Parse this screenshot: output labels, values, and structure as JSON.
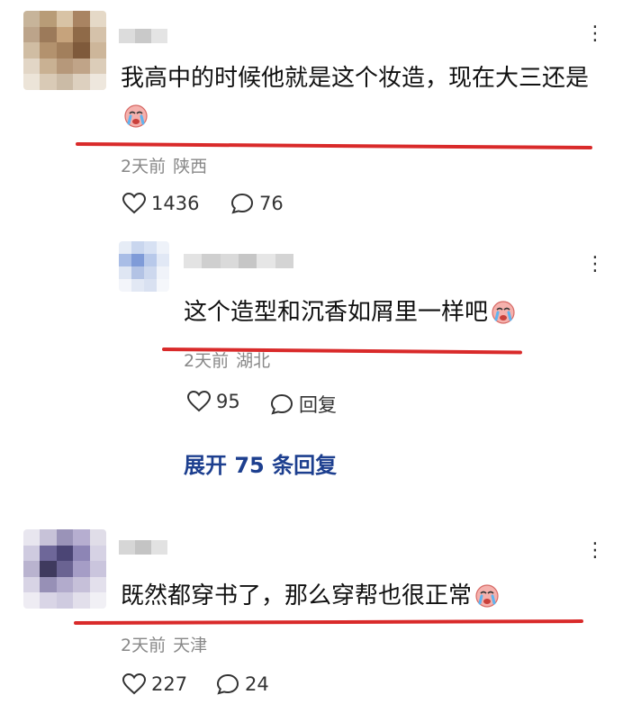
{
  "comments": [
    {
      "text": "我高中的时候他就是这个妆造，现在大三还是",
      "meta_time": "2天前",
      "meta_location": "陕西",
      "likes": "1436",
      "replies": "76"
    },
    {
      "text": "这个造型和沉香如屑里一样吧",
      "meta_time": "2天前",
      "meta_location": "湖北",
      "likes": "95",
      "reply_label": "回复"
    },
    {
      "expand_label": "展开 75 条回复"
    },
    {
      "text": "既然都穿书了，那么穿帮也很正常",
      "meta_time": "2天前",
      "meta_location": "天津",
      "likes": "227",
      "replies": "24"
    }
  ],
  "more_glyph": "⋮",
  "colors": {
    "underline": "#d92a2a",
    "expand_link": "#1d3f8f",
    "meta_text": "#888888"
  },
  "icons": [
    "heart-icon",
    "comment-bubble-icon",
    "more-options-icon",
    "crying-emoji-icon"
  ]
}
